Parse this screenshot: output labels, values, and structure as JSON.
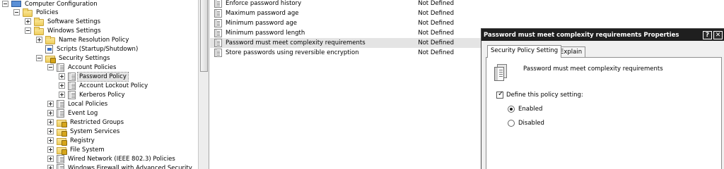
{
  "tree": {
    "items": [
      {
        "label": "Computer Configuration",
        "expander": "minus",
        "icon": "computer-icon"
      },
      {
        "label": "Policies",
        "expander": "minus",
        "icon": "folder-icon"
      },
      {
        "label": "Software Settings",
        "expander": "plus",
        "icon": "folder-icon"
      },
      {
        "label": "Windows Settings",
        "expander": "minus",
        "icon": "folder-icon"
      },
      {
        "label": "Name Resolution Policy",
        "expander": "plus",
        "icon": "folder-icon"
      },
      {
        "label": "Scripts (Startup/Shutdown)",
        "expander": "none",
        "icon": "script-icon"
      },
      {
        "label": "Security Settings",
        "expander": "minus",
        "icon": "lock-folder-icon"
      },
      {
        "label": "Account Policies",
        "expander": "minus",
        "icon": "policy-icon"
      },
      {
        "label": "Password Policy",
        "expander": "plus",
        "icon": "policy-icon",
        "selected": true
      },
      {
        "label": "Account Lockout Policy",
        "expander": "plus",
        "icon": "policy-icon"
      },
      {
        "label": "Kerberos Policy",
        "expander": "plus",
        "icon": "policy-icon"
      },
      {
        "label": "Local Policies",
        "expander": "plus",
        "icon": "policy-icon"
      },
      {
        "label": "Event Log",
        "expander": "plus",
        "icon": "policy-icon"
      },
      {
        "label": "Restricted Groups",
        "expander": "plus",
        "icon": "lock-folder-icon"
      },
      {
        "label": "System Services",
        "expander": "plus",
        "icon": "lock-folder-icon"
      },
      {
        "label": "Registry",
        "expander": "plus",
        "icon": "lock-folder-icon"
      },
      {
        "label": "File System",
        "expander": "plus",
        "icon": "lock-folder-icon"
      },
      {
        "label": "Wired Network (IEEE 802.3) Policies",
        "expander": "plus",
        "icon": "policy-icon"
      },
      {
        "label": "Windows Firewall with Advanced Security",
        "expander": "plus",
        "icon": "policy-icon"
      }
    ]
  },
  "list": {
    "rows": [
      {
        "name": "Enforce password history",
        "setting": "Not Defined"
      },
      {
        "name": "Maximum password age",
        "setting": "Not Defined"
      },
      {
        "name": "Minimum password age",
        "setting": "Not Defined"
      },
      {
        "name": "Minimum password length",
        "setting": "Not Defined"
      },
      {
        "name": "Password must meet complexity requirements",
        "setting": "Not Defined",
        "selected": true
      },
      {
        "name": "Store passwords using reversible encryption",
        "setting": "Not Defined"
      }
    ]
  },
  "dialog": {
    "title": "Password must meet complexity requirements Properties",
    "help_glyph": "?",
    "close_glyph": "✕",
    "tabs": [
      "Security Policy Setting",
      "Explain"
    ],
    "policy_name": "Password must meet complexity requirements",
    "define_label": "Define this policy setting:",
    "define_checked": true,
    "options": [
      {
        "label": "Enabled",
        "selected": true
      },
      {
        "label": "Disabled",
        "selected": false
      }
    ]
  }
}
